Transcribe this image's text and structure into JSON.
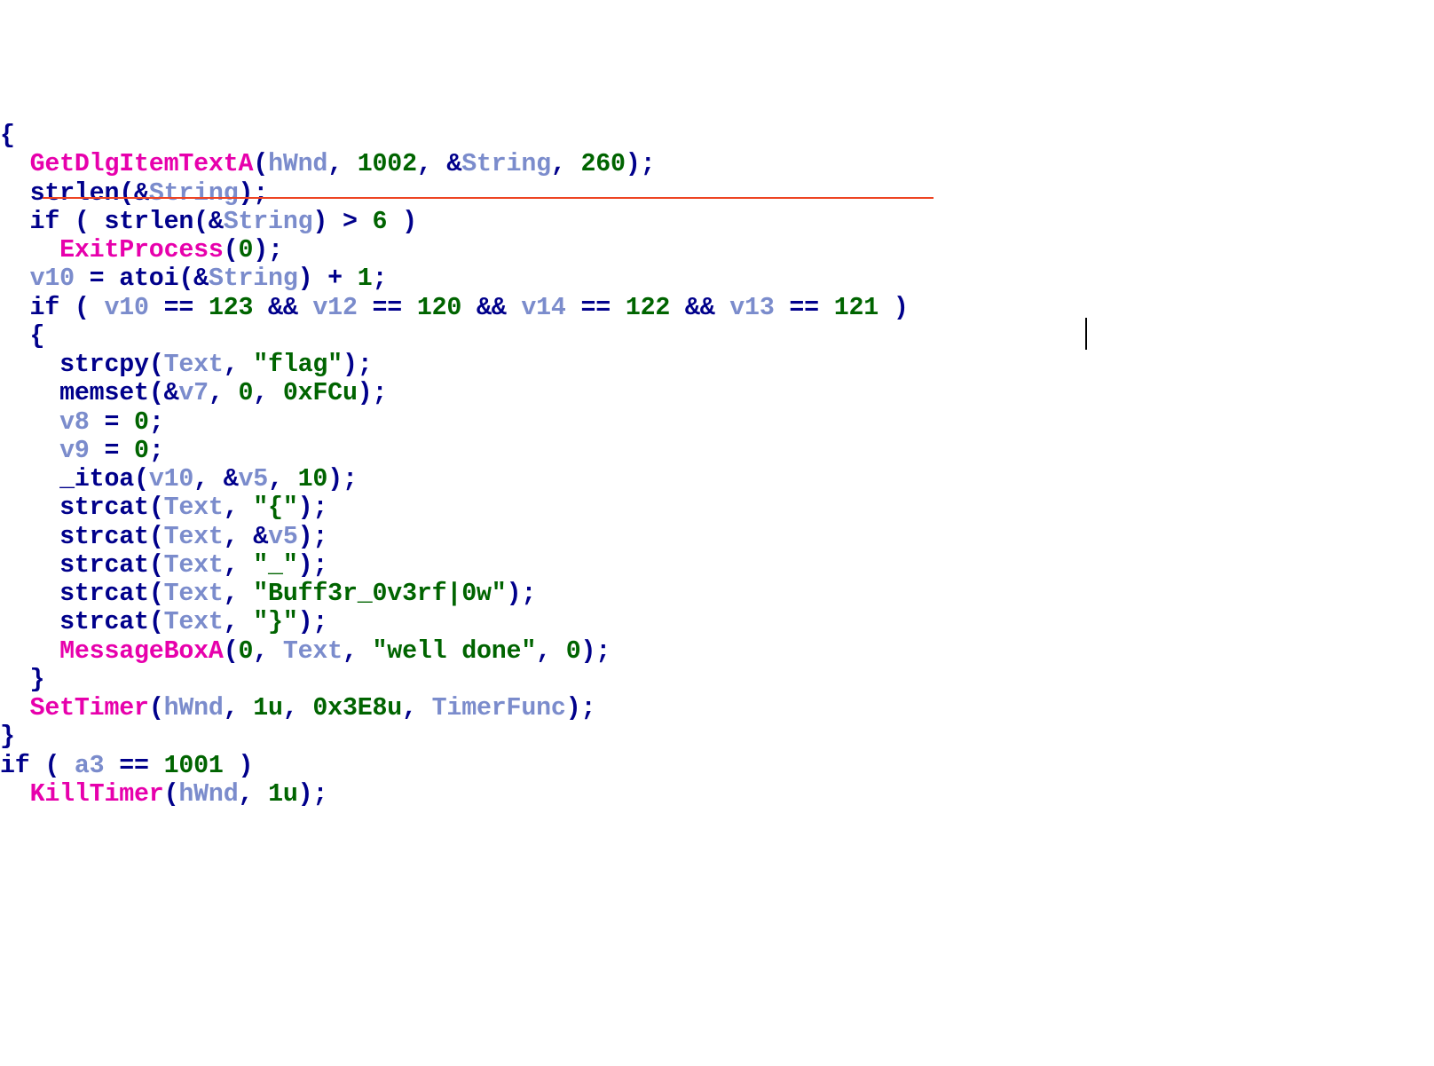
{
  "lines": [
    [
      {
        "t": "{",
        "c": "op"
      }
    ],
    [
      {
        "t": "  ",
        "c": "op"
      },
      {
        "t": "GetDlgItemTextA",
        "c": "pink"
      },
      {
        "t": "(",
        "c": "op"
      },
      {
        "t": "hWnd",
        "c": "var"
      },
      {
        "t": ", ",
        "c": "op"
      },
      {
        "t": "1002",
        "c": "num"
      },
      {
        "t": ", &",
        "c": "op"
      },
      {
        "t": "String",
        "c": "var"
      },
      {
        "t": ", ",
        "c": "op"
      },
      {
        "t": "260",
        "c": "num"
      },
      {
        "t": ");",
        "c": "op"
      }
    ],
    [
      {
        "t": "  ",
        "c": "op"
      },
      {
        "t": "strlen",
        "c": "kw"
      },
      {
        "t": "(&",
        "c": "op"
      },
      {
        "t": "String",
        "c": "var"
      },
      {
        "t": ");",
        "c": "op"
      }
    ],
    [
      {
        "t": "  if ( ",
        "c": "kw"
      },
      {
        "t": "strlen",
        "c": "kw"
      },
      {
        "t": "(&",
        "c": "op"
      },
      {
        "t": "String",
        "c": "var"
      },
      {
        "t": ") > ",
        "c": "op"
      },
      {
        "t": "6",
        "c": "num"
      },
      {
        "t": " )",
        "c": "op"
      }
    ],
    [
      {
        "t": "    ",
        "c": "op"
      },
      {
        "t": "ExitProcess",
        "c": "pink"
      },
      {
        "t": "(",
        "c": "op"
      },
      {
        "t": "0",
        "c": "num"
      },
      {
        "t": ");",
        "c": "op"
      }
    ],
    [
      {
        "t": "  ",
        "c": "op"
      },
      {
        "t": "v10",
        "c": "var"
      },
      {
        "t": " = ",
        "c": "op"
      },
      {
        "t": "atoi",
        "c": "kw"
      },
      {
        "t": "(&",
        "c": "op"
      },
      {
        "t": "String",
        "c": "var"
      },
      {
        "t": ") + ",
        "c": "op"
      },
      {
        "t": "1",
        "c": "num"
      },
      {
        "t": ";",
        "c": "op"
      }
    ],
    [
      {
        "t": "  if ( ",
        "c": "kw"
      },
      {
        "t": "v10",
        "c": "var"
      },
      {
        "t": " == ",
        "c": "op"
      },
      {
        "t": "123",
        "c": "num"
      },
      {
        "t": " && ",
        "c": "op"
      },
      {
        "t": "v12",
        "c": "var"
      },
      {
        "t": " == ",
        "c": "op"
      },
      {
        "t": "120",
        "c": "num"
      },
      {
        "t": " && ",
        "c": "op"
      },
      {
        "t": "v14",
        "c": "var"
      },
      {
        "t": " == ",
        "c": "op"
      },
      {
        "t": "122",
        "c": "num"
      },
      {
        "t": " && ",
        "c": "op"
      },
      {
        "t": "v13",
        "c": "var"
      },
      {
        "t": " == ",
        "c": "op"
      },
      {
        "t": "121",
        "c": "num"
      },
      {
        "t": " )",
        "c": "op"
      }
    ],
    [
      {
        "t": "  {",
        "c": "op"
      }
    ],
    [
      {
        "t": "    ",
        "c": "op"
      },
      {
        "t": "strcpy",
        "c": "kw"
      },
      {
        "t": "(",
        "c": "op"
      },
      {
        "t": "Text",
        "c": "var"
      },
      {
        "t": ", ",
        "c": "op"
      },
      {
        "t": "\"flag\"",
        "c": "green"
      },
      {
        "t": ");",
        "c": "op"
      }
    ],
    [
      {
        "t": "    ",
        "c": "op"
      },
      {
        "t": "memset",
        "c": "kw"
      },
      {
        "t": "(&",
        "c": "op"
      },
      {
        "t": "v7",
        "c": "var"
      },
      {
        "t": ", ",
        "c": "op"
      },
      {
        "t": "0",
        "c": "num"
      },
      {
        "t": ", ",
        "c": "op"
      },
      {
        "t": "0xFCu",
        "c": "num"
      },
      {
        "t": ");",
        "c": "op"
      }
    ],
    [
      {
        "t": "    ",
        "c": "op"
      },
      {
        "t": "v8",
        "c": "var"
      },
      {
        "t": " = ",
        "c": "op"
      },
      {
        "t": "0",
        "c": "num"
      },
      {
        "t": ";",
        "c": "op"
      }
    ],
    [
      {
        "t": "    ",
        "c": "op"
      },
      {
        "t": "v9",
        "c": "var"
      },
      {
        "t": " = ",
        "c": "op"
      },
      {
        "t": "0",
        "c": "num"
      },
      {
        "t": ";",
        "c": "op"
      }
    ],
    [
      {
        "t": "    ",
        "c": "op"
      },
      {
        "t": "_itoa",
        "c": "kw"
      },
      {
        "t": "(",
        "c": "op"
      },
      {
        "t": "v10",
        "c": "var"
      },
      {
        "t": ", &",
        "c": "op"
      },
      {
        "t": "v5",
        "c": "var"
      },
      {
        "t": ", ",
        "c": "op"
      },
      {
        "t": "10",
        "c": "num"
      },
      {
        "t": ");",
        "c": "op"
      }
    ],
    [
      {
        "t": "    ",
        "c": "op"
      },
      {
        "t": "strcat",
        "c": "kw"
      },
      {
        "t": "(",
        "c": "op"
      },
      {
        "t": "Text",
        "c": "var"
      },
      {
        "t": ", ",
        "c": "op"
      },
      {
        "t": "\"{\"",
        "c": "green"
      },
      {
        "t": ");",
        "c": "op"
      }
    ],
    [
      {
        "t": "    ",
        "c": "op"
      },
      {
        "t": "strcat",
        "c": "kw"
      },
      {
        "t": "(",
        "c": "op"
      },
      {
        "t": "Text",
        "c": "var"
      },
      {
        "t": ", &",
        "c": "op"
      },
      {
        "t": "v5",
        "c": "var"
      },
      {
        "t": ");",
        "c": "op"
      }
    ],
    [
      {
        "t": "    ",
        "c": "op"
      },
      {
        "t": "strcat",
        "c": "kw"
      },
      {
        "t": "(",
        "c": "op"
      },
      {
        "t": "Text",
        "c": "var"
      },
      {
        "t": ", ",
        "c": "op"
      },
      {
        "t": "\"_\"",
        "c": "green"
      },
      {
        "t": ");",
        "c": "op"
      }
    ],
    [
      {
        "t": "    ",
        "c": "op"
      },
      {
        "t": "strcat",
        "c": "kw"
      },
      {
        "t": "(",
        "c": "op"
      },
      {
        "t": "Text",
        "c": "var"
      },
      {
        "t": ", ",
        "c": "op"
      },
      {
        "t": "\"Buff3r_0v3rf|0w\"",
        "c": "green"
      },
      {
        "t": ");",
        "c": "op"
      }
    ],
    [
      {
        "t": "    ",
        "c": "op"
      },
      {
        "t": "strcat",
        "c": "kw"
      },
      {
        "t": "(",
        "c": "op"
      },
      {
        "t": "Text",
        "c": "var"
      },
      {
        "t": ", ",
        "c": "op"
      },
      {
        "t": "\"}\"",
        "c": "green"
      },
      {
        "t": ");",
        "c": "op"
      }
    ],
    [
      {
        "t": "    ",
        "c": "op"
      },
      {
        "t": "MessageBoxA",
        "c": "pink"
      },
      {
        "t": "(",
        "c": "op"
      },
      {
        "t": "0",
        "c": "num"
      },
      {
        "t": ", ",
        "c": "op"
      },
      {
        "t": "Text",
        "c": "var"
      },
      {
        "t": ", ",
        "c": "op"
      },
      {
        "t": "\"well done\"",
        "c": "green"
      },
      {
        "t": ", ",
        "c": "op"
      },
      {
        "t": "0",
        "c": "num"
      },
      {
        "t": ");",
        "c": "op"
      }
    ],
    [
      {
        "t": "  }",
        "c": "op"
      }
    ],
    [
      {
        "t": "  ",
        "c": "op"
      },
      {
        "t": "SetTimer",
        "c": "pink"
      },
      {
        "t": "(",
        "c": "op"
      },
      {
        "t": "hWnd",
        "c": "var"
      },
      {
        "t": ", ",
        "c": "op"
      },
      {
        "t": "1u",
        "c": "num"
      },
      {
        "t": ", ",
        "c": "op"
      },
      {
        "t": "0x3E8u",
        "c": "num"
      },
      {
        "t": ", ",
        "c": "op"
      },
      {
        "t": "TimerFunc",
        "c": "var"
      },
      {
        "t": ");",
        "c": "op"
      }
    ],
    [
      {
        "t": "}",
        "c": "op"
      }
    ],
    [
      {
        "t": "if ( ",
        "c": "kw"
      },
      {
        "t": "a3",
        "c": "var"
      },
      {
        "t": " == ",
        "c": "op"
      },
      {
        "t": "1001",
        "c": "num"
      },
      {
        "t": " )",
        "c": "op"
      }
    ],
    [
      {
        "t": "  ",
        "c": "op"
      },
      {
        "t": "KillTimer",
        "c": "pink"
      },
      {
        "t": "(",
        "c": "op"
      },
      {
        "t": "hWnd",
        "c": "var"
      },
      {
        "t": ", ",
        "c": "op"
      },
      {
        "t": "1u",
        "c": "num"
      },
      {
        "t": ");",
        "c": "op"
      }
    ]
  ]
}
